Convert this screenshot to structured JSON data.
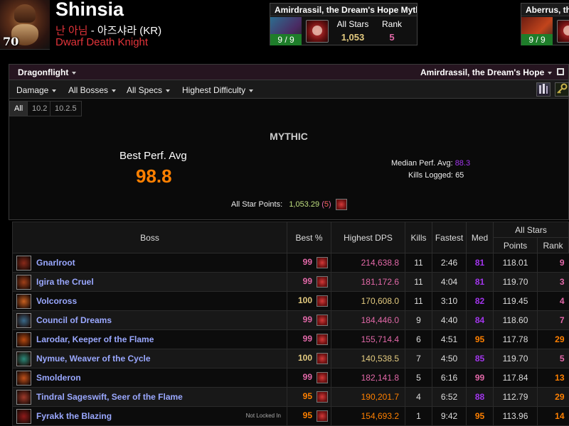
{
  "character": {
    "name": "Shinsia",
    "level": "70",
    "guild": "난 아님",
    "realm": "아즈샤라 (KR)",
    "class": "Dwarf Death Knight"
  },
  "zone_cards": [
    {
      "title": "Amirdrassil, the Dream's Hope Mythic",
      "progress": "9 / 9",
      "all_stars_label": "All Stars",
      "all_stars_value": "1,053",
      "rank_label": "Rank",
      "rank_value": "5"
    },
    {
      "title": "Aberrus, the Shadowed Crucible Mythic",
      "progress": "9 / 9"
    }
  ],
  "filters": {
    "expansion": "Dragonflight",
    "zone": "Amirdrassil, the Dream's Hope",
    "metric": "Damage",
    "bosses": "All Bosses",
    "specs": "All Specs",
    "difficulty": "Highest Difficulty",
    "partitions": [
      "All",
      "10.2",
      "10.2.5"
    ]
  },
  "summary": {
    "difficulty": "MYTHIC",
    "best_perf_label": "Best Perf. Avg",
    "best_perf_value": "98.8",
    "median_label": "Median Perf. Avg:",
    "median_value": "88.3",
    "kills_label": "Kills Logged:",
    "kills_value": "65",
    "all_star_label": "All Star Points:",
    "all_star_value": "1,053.29",
    "all_star_rank": "5"
  },
  "table": {
    "headers": {
      "boss": "Boss",
      "best": "Best %",
      "dps": "Highest DPS",
      "kills": "Kills",
      "fastest": "Fastest",
      "med": "Med",
      "allstars": "All Stars",
      "points": "Points",
      "rank": "Rank"
    },
    "rows": [
      {
        "boss": "Gnarlroot",
        "best": "99",
        "dps": "214,638.8",
        "kills": "11",
        "fastest": "2:46",
        "med": "81",
        "points": "118.01",
        "rank": "9",
        "note": ""
      },
      {
        "boss": "Igira the Cruel",
        "best": "99",
        "dps": "181,172.6",
        "kills": "11",
        "fastest": "4:04",
        "med": "81",
        "points": "119.70",
        "rank": "3",
        "note": ""
      },
      {
        "boss": "Volcoross",
        "best": "100",
        "dps": "170,608.0",
        "kills": "11",
        "fastest": "3:10",
        "med": "82",
        "points": "119.45",
        "rank": "4",
        "note": ""
      },
      {
        "boss": "Council of Dreams",
        "best": "99",
        "dps": "184,446.0",
        "kills": "9",
        "fastest": "4:40",
        "med": "84",
        "points": "118.60",
        "rank": "7",
        "note": ""
      },
      {
        "boss": "Larodar, Keeper of the Flame",
        "best": "99",
        "dps": "155,714.4",
        "kills": "6",
        "fastest": "4:51",
        "med": "95",
        "points": "117.78",
        "rank": "29",
        "note": ""
      },
      {
        "boss": "Nymue, Weaver of the Cycle",
        "best": "100",
        "dps": "140,538.5",
        "kills": "7",
        "fastest": "4:50",
        "med": "85",
        "points": "119.70",
        "rank": "5",
        "note": ""
      },
      {
        "boss": "Smolderon",
        "best": "99",
        "dps": "182,141.8",
        "kills": "5",
        "fastest": "6:16",
        "med": "99",
        "points": "117.84",
        "rank": "13",
        "note": ""
      },
      {
        "boss": "Tindral Sageswift, Seer of the Flame",
        "best": "95",
        "dps": "190,201.7",
        "kills": "4",
        "fastest": "6:52",
        "med": "88",
        "points": "112.79",
        "rank": "29",
        "note": ""
      },
      {
        "boss": "Fyrakk the Blazing",
        "best": "95",
        "dps": "154,693.2",
        "kills": "1",
        "fastest": "9:42",
        "med": "95",
        "points": "113.96",
        "rank": "14",
        "note": "Not Locked In"
      }
    ]
  },
  "colors": {
    "legendary": "#ff8000",
    "astounding": "#e268a8",
    "epic": "#a335ee",
    "artifact": "#e5cc80",
    "dk_red": "#e2343a"
  }
}
